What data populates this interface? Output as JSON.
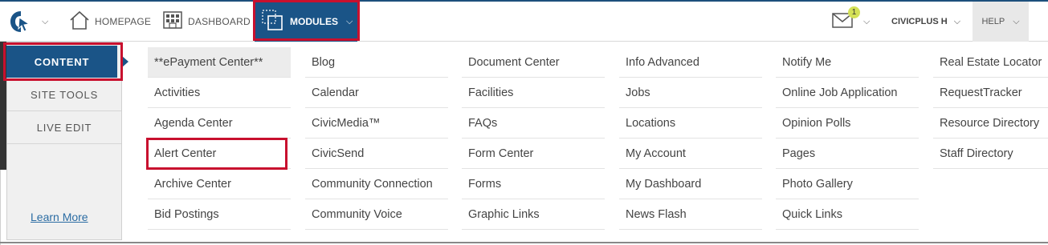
{
  "topbar": {
    "home_label": "HOMEPAGE",
    "dashboard_label": "DASHBOARD",
    "modules_label": "MODULES",
    "notification_count": "1",
    "user_label": "CIVICPLUS H",
    "help_label": "HELP",
    "chevron": "⌵"
  },
  "sidebar": {
    "items": [
      {
        "label": "CONTENT"
      },
      {
        "label": "SITE TOOLS"
      },
      {
        "label": "LIVE EDIT"
      }
    ],
    "learn_more": "Learn More"
  },
  "columns": [
    [
      "**ePayment Center**",
      "Activities",
      "Agenda Center",
      "Alert Center",
      "Archive Center",
      "Bid Postings"
    ],
    [
      "Blog",
      "Calendar",
      "CivicMedia™",
      "CivicSend",
      "Community Connection",
      "Community Voice"
    ],
    [
      "Document Center",
      "Facilities",
      "FAQs",
      "Form Center",
      "Forms",
      "Graphic Links"
    ],
    [
      "Info Advanced",
      "Jobs",
      "Locations",
      "My Account",
      "My Dashboard",
      "News Flash"
    ],
    [
      "Notify Me",
      "Online Job Application",
      "Opinion Polls",
      "Pages",
      "Photo Gallery",
      "Quick Links"
    ],
    [
      "Real Estate Locator",
      "RequestTracker",
      "Resource Directory",
      "Staff Directory"
    ]
  ],
  "colors": {
    "accent": "#1a5487",
    "highlight_box": "#c8102e",
    "badge": "#d4e157"
  }
}
